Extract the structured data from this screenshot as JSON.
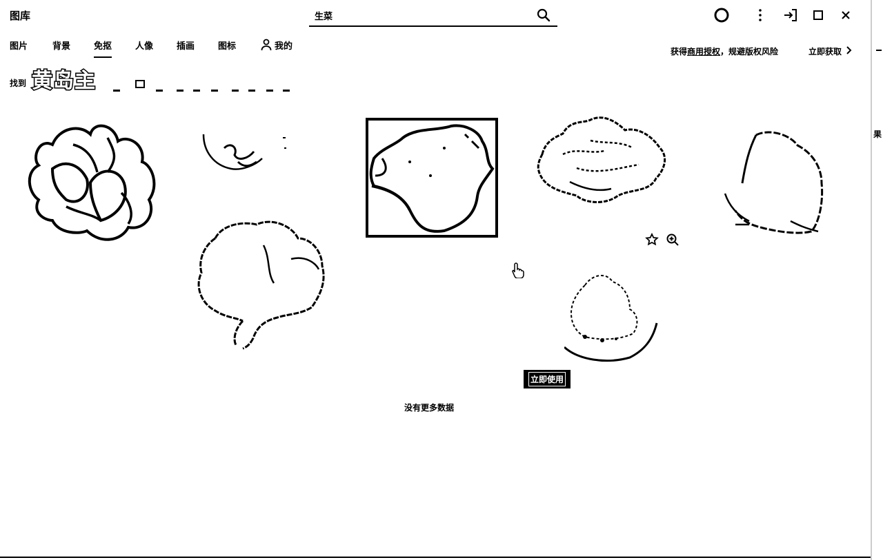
{
  "window": {
    "title": "图库",
    "search": {
      "value": "生菜",
      "placeholder": ""
    }
  },
  "tabs": [
    {
      "label": "图片",
      "active": false
    },
    {
      "label": "背景",
      "active": false
    },
    {
      "label": "免抠",
      "active": true
    },
    {
      "label": "人像",
      "active": false
    },
    {
      "label": "插画",
      "active": false
    },
    {
      "label": "图标",
      "active": false
    },
    {
      "label": "我的",
      "active": false
    }
  ],
  "promo": {
    "prefix": "获得",
    "link": "商用授权",
    "suffix": "，规避版权风险",
    "cta": "立即获取"
  },
  "filter": {
    "label": "找到",
    "stamp_text": "黄岛主"
  },
  "results": {
    "hover_use_label": "立即使用",
    "end_text": "没有更多数据"
  },
  "side_text": "果",
  "icons": {
    "search": "search-icon",
    "profile": "circle-icon",
    "more": "more-vertical-icon",
    "login": "sign-in-icon",
    "maximize": "maximize-icon",
    "close": "close-icon",
    "mine": "user-icon",
    "favorite": "star-icon",
    "zoom": "zoom-in-icon",
    "cursor": "hand-pointer-icon",
    "chevron": "chevron-right-icon"
  }
}
